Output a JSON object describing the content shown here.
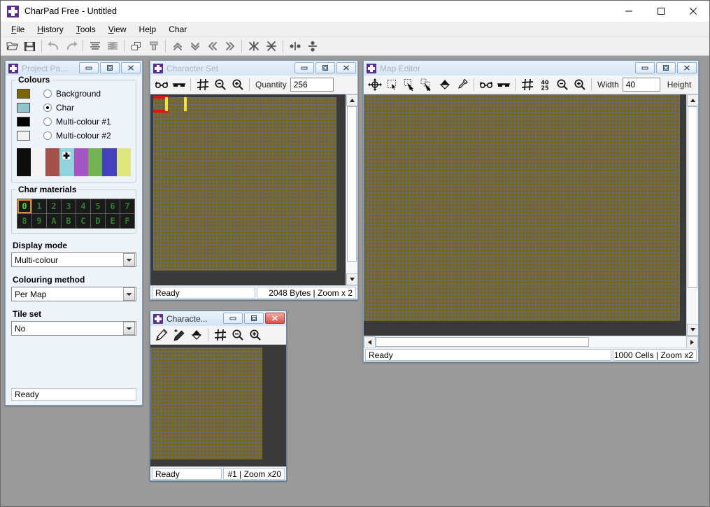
{
  "app": {
    "title": "CharPad Free - Untitled",
    "icon": "charpad-icon",
    "window_buttons": {
      "minimize": "minimize-icon",
      "maximize": "maximize-icon",
      "close": "close-icon"
    }
  },
  "menubar": {
    "items": [
      {
        "label": "File",
        "accel": "F"
      },
      {
        "label": "History",
        "accel": "H"
      },
      {
        "label": "Tools",
        "accel": "T"
      },
      {
        "label": "View",
        "accel": "V"
      },
      {
        "label": "Help",
        "accel": "H"
      },
      {
        "label": "Char",
        "accel": ""
      }
    ]
  },
  "toolbar": {
    "buttons": [
      "open-icon",
      "save-icon",
      "sep",
      "undo-icon",
      "redo-icon",
      "sep",
      "align-lines-icon",
      "zigzag-lines-icon",
      "sep",
      "copy-icon",
      "paste-icon",
      "sep",
      "move-up-icon",
      "move-down-icon",
      "move-left-icon",
      "move-right-icon",
      "sep",
      "collapse-horizontal-icon",
      "collapse-vertical-icon",
      "sep",
      "split-horizontal-icon",
      "split-vertical-icon"
    ]
  },
  "project_panel": {
    "title": "Project Pa...",
    "active": false,
    "window_buttons": [
      "minimize-icon",
      "restore-icon",
      "close-icon"
    ],
    "colours": {
      "group_title": "Colours",
      "rows": [
        {
          "label": "Background",
          "swatch": "#7a6508",
          "selected": false
        },
        {
          "label": "Char",
          "swatch": "#8fc4cc",
          "selected": true
        },
        {
          "label": "Multi-colour #1",
          "swatch": "#000000",
          "selected": false
        },
        {
          "label": "Multi-colour #2",
          "swatch": "#f2f2f2",
          "selected": false
        }
      ],
      "palette": [
        {
          "hex": "#0d0d0d",
          "marked": false
        },
        {
          "hex": "#f4f4f4",
          "marked": false
        },
        {
          "hex": "#a6504a",
          "marked": false
        },
        {
          "hex": "#8fd4dc",
          "marked": true
        },
        {
          "hex": "#a554c4",
          "marked": false
        },
        {
          "hex": "#72b454",
          "marked": false
        },
        {
          "hex": "#4540bc",
          "marked": false
        },
        {
          "hex": "#dce57e",
          "marked": false
        }
      ]
    },
    "char_materials": {
      "group_title": "Char materials",
      "cells": [
        "0",
        "1",
        "2",
        "3",
        "4",
        "5",
        "6",
        "7",
        "8",
        "9",
        "A",
        "B",
        "C",
        "D",
        "E",
        "F"
      ],
      "selected_index": 0,
      "selected_colour": "#e08a2b",
      "digit_colour": "#47d847"
    },
    "display_mode": {
      "label": "Display mode",
      "value": "Multi-colour"
    },
    "colouring_method": {
      "label": "Colouring method",
      "value": "Per Map"
    },
    "tile_set": {
      "label": "Tile set",
      "value": "No"
    },
    "status": "Ready"
  },
  "character_set": {
    "title": "Character Set",
    "active": false,
    "window_buttons": [
      "minimize-icon",
      "restore-icon",
      "close-icon"
    ],
    "toolbar": [
      "glasses-open-icon",
      "glasses-closed-icon",
      "grid-icon",
      "zoom-out-icon",
      "zoom-in-icon"
    ],
    "quantity_label": "Quantity",
    "quantity_value": "256",
    "canvas_bg": "#7a6508",
    "status_left": "Ready",
    "status_right": "2048 Bytes | Zoom x 2"
  },
  "map_editor": {
    "title": "Map Editor",
    "active": false,
    "window_buttons": [
      "minimize-icon",
      "restore-icon",
      "close-icon"
    ],
    "toolbar": [
      "move-tool-icon",
      "select-tool-icon",
      "pick-tool-icon",
      "clone-tool-icon",
      "fill-tool-icon",
      "eyedropper-icon",
      "sep",
      "glasses-open-icon",
      "glasses-closed-icon",
      "grid-icon",
      "dimensions-4025-icon",
      "zoom-out-icon",
      "zoom-in-icon"
    ],
    "width_label": "Width",
    "width_value": "40",
    "height_label": "Height",
    "canvas_bg": "#7a6508",
    "status_left": "Ready",
    "status_right": "1000 Cells | Zoom x2"
  },
  "character_editor": {
    "title": "Characte...",
    "active": true,
    "window_buttons": [
      "minimize-icon",
      "restore-icon",
      "close-icon"
    ],
    "toolbar": [
      "pencil-icon",
      "pencil-plus-icon",
      "fill-tool-icon",
      "sep",
      "grid-icon",
      "zoom-out-icon",
      "zoom-in-icon"
    ],
    "canvas_bg": "#7a6508",
    "status_left": "Ready",
    "status_right": "#1 | Zoom x20"
  }
}
